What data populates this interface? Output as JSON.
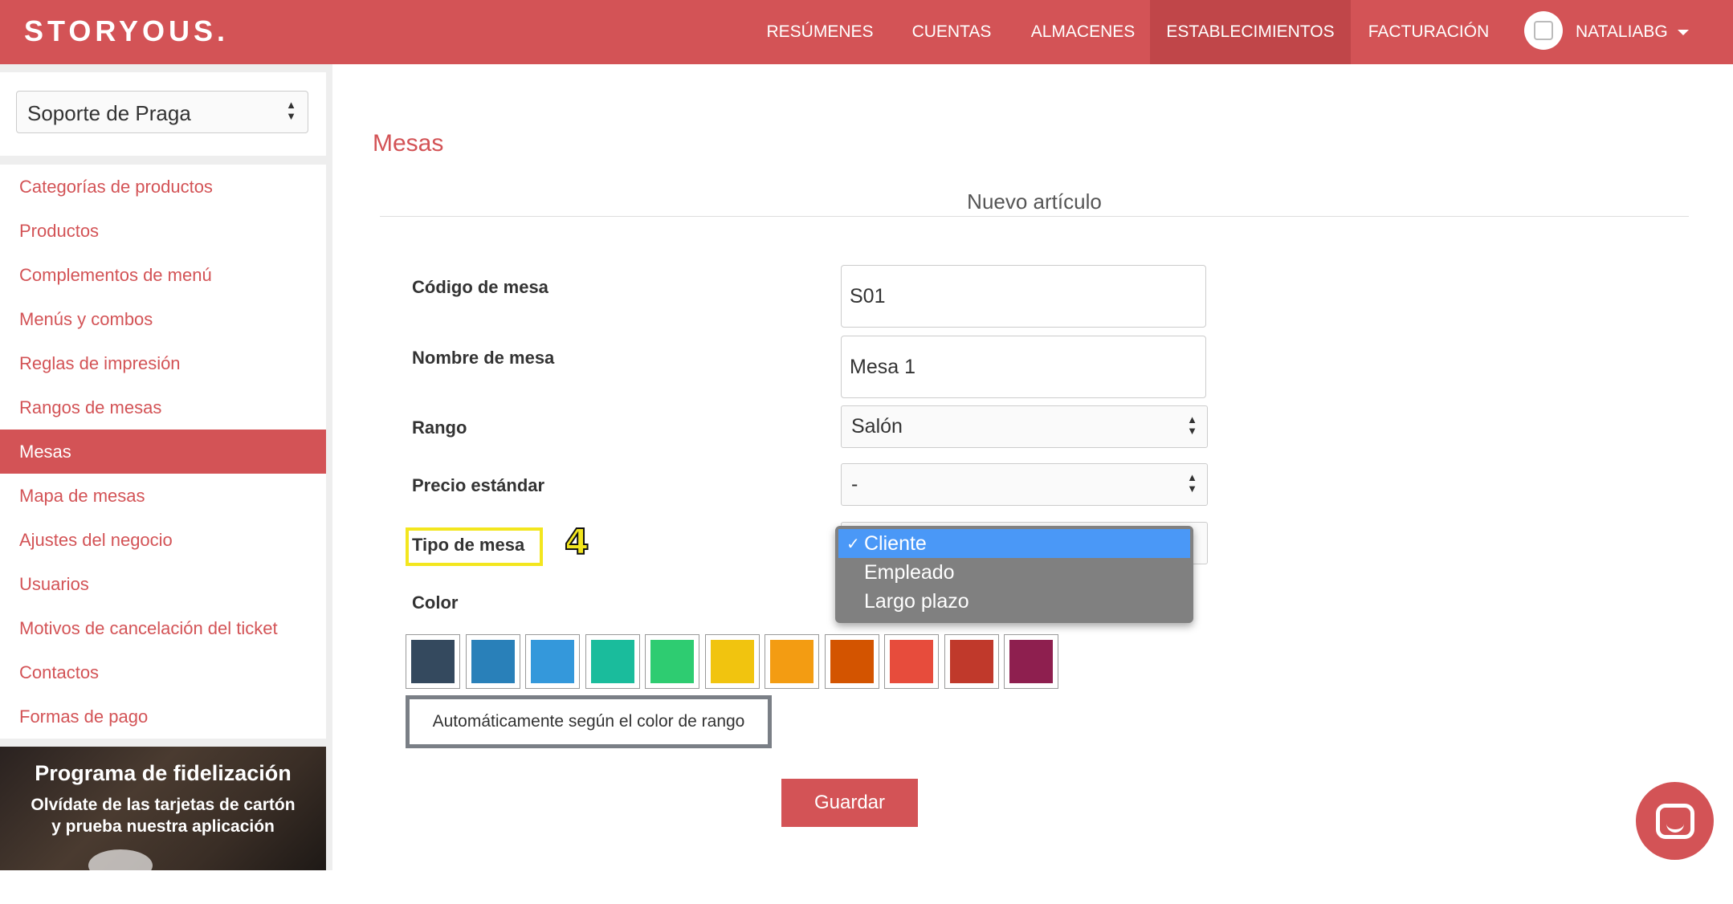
{
  "app": {
    "logo": "STORYOUS."
  },
  "topnav": {
    "items": [
      {
        "label": "RESÚMENES"
      },
      {
        "label": "CUENTAS"
      },
      {
        "label": "ALMACENES"
      },
      {
        "label": "ESTABLECIMIENTOS",
        "active": true
      },
      {
        "label": "FACTURACIÓN"
      }
    ],
    "user": "NATALIABG"
  },
  "sidebar": {
    "establishment_select": "Soporte de Praga",
    "items": [
      {
        "label": "Categorías de productos"
      },
      {
        "label": "Productos"
      },
      {
        "label": "Complementos de menú"
      },
      {
        "label": "Menús y combos"
      },
      {
        "label": "Reglas de impresión"
      },
      {
        "label": "Rangos de mesas"
      },
      {
        "label": "Mesas",
        "active": true
      },
      {
        "label": "Mapa de mesas"
      },
      {
        "label": "Ajustes del negocio"
      },
      {
        "label": "Usuarios"
      },
      {
        "label": "Motivos de cancelación del ticket"
      },
      {
        "label": "Contactos"
      },
      {
        "label": "Formas de pago"
      }
    ],
    "promo": {
      "title": "Programa de fidelización",
      "line1": "Olvídate de las tarjetas de cartón",
      "line2": "y prueba nuestra aplicación"
    }
  },
  "main": {
    "page_title": "Mesas",
    "form_title": "Nuevo artículo",
    "fields": {
      "code": {
        "label": "Código de mesa",
        "value": "S01"
      },
      "name": {
        "label": "Nombre de mesa",
        "value": "Mesa 1"
      },
      "range": {
        "label": "Rango",
        "value": "Salón"
      },
      "price": {
        "label": "Precio estándar",
        "value": "-"
      },
      "type": {
        "label": "Tipo de mesa",
        "options": [
          "Cliente",
          "Empleado",
          "Largo plazo"
        ],
        "selected": "Cliente"
      },
      "color": {
        "label": "Color"
      }
    },
    "annotation_step": "4",
    "color_swatches": [
      "#34495e",
      "#2980b9",
      "#3498db",
      "#1abc9c",
      "#2ecc71",
      "#f1c40f",
      "#f39c12",
      "#d35400",
      "#e74c3c",
      "#c0392b",
      "#8e1f4f"
    ],
    "auto_color_button": "Automáticamente según el color de rango",
    "save_button": "Guardar"
  }
}
